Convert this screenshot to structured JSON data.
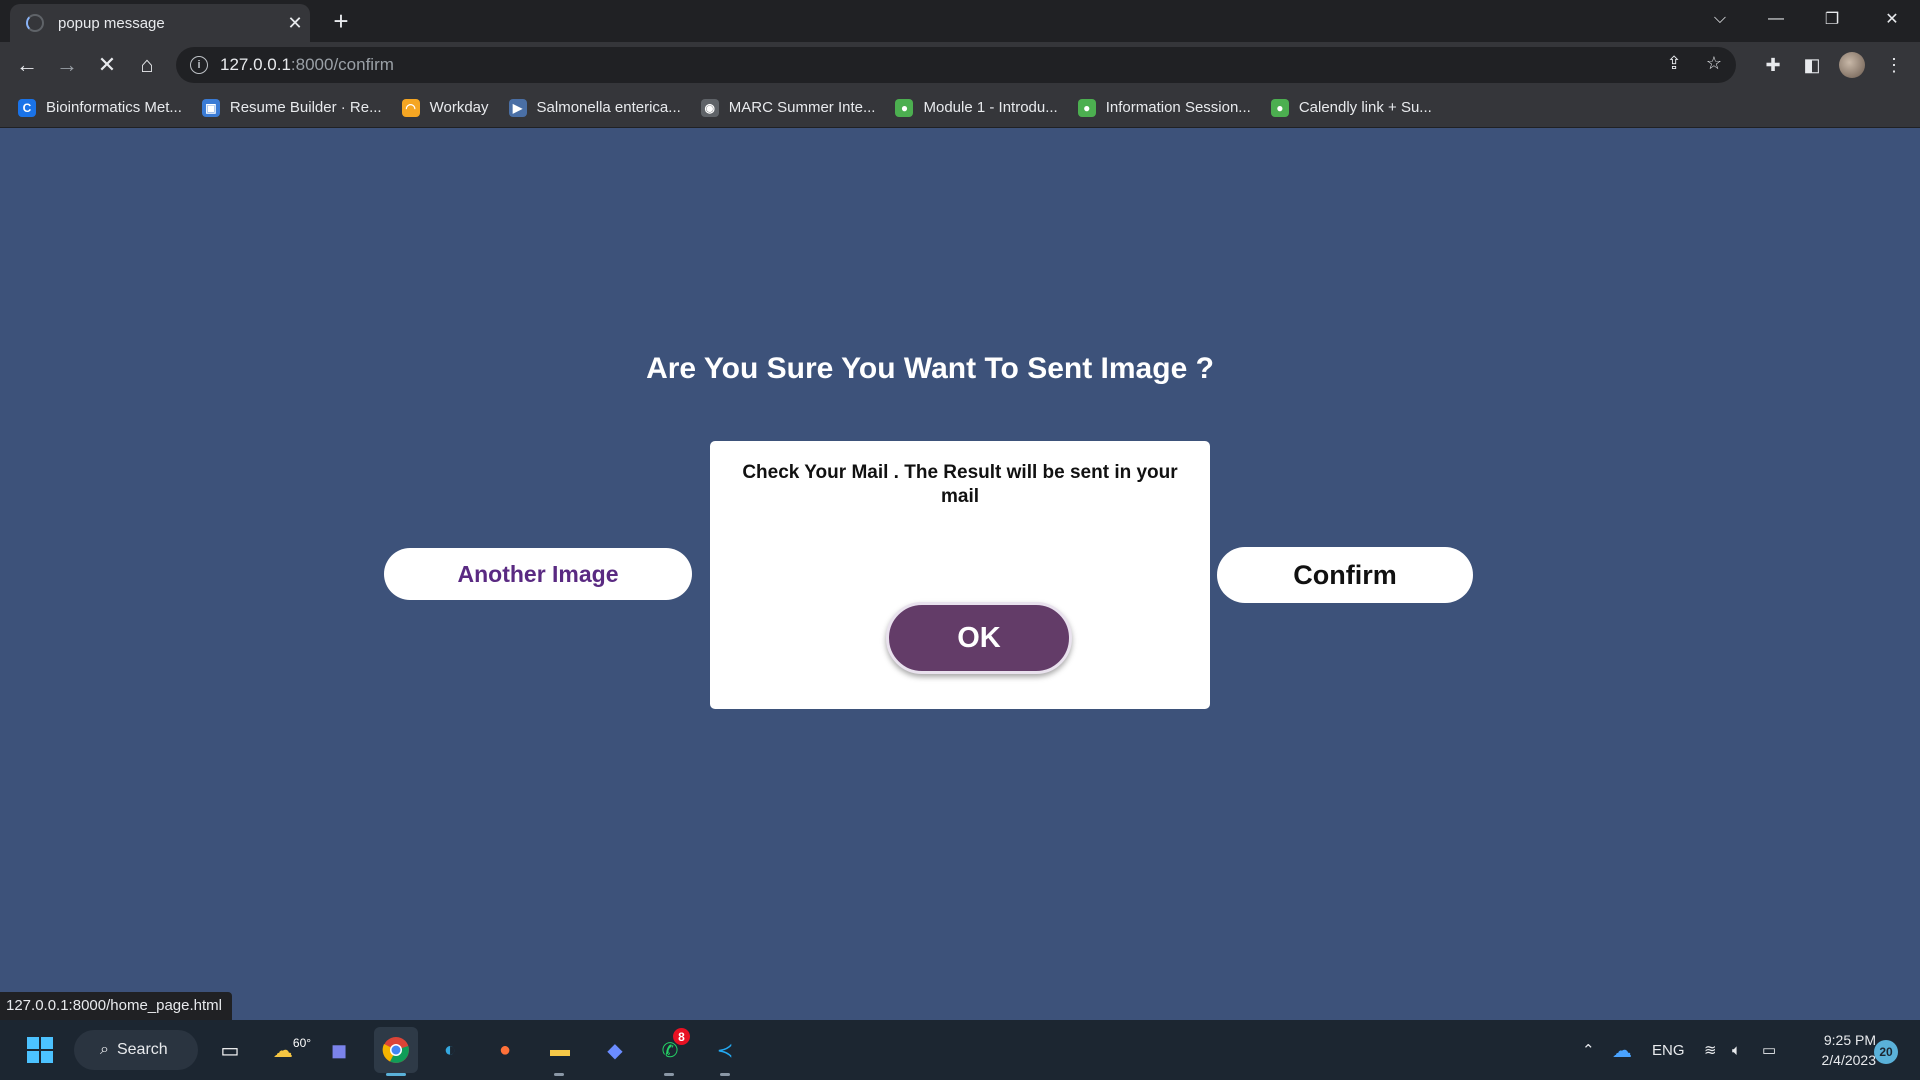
{
  "browser": {
    "tab_title": "popup message",
    "new_tab": "+",
    "url_host": "127.0.0.1",
    "url_path": ":8000/confirm",
    "bookmarks": [
      {
        "label": "Bioinformatics Met...",
        "icon": "c-logo-icon",
        "color": "#1a73e8",
        "glyph": "C"
      },
      {
        "label": "Resume Builder · Re...",
        "icon": "resume-icon",
        "color": "#3a7bd5",
        "glyph": "▣"
      },
      {
        "label": "Workday",
        "icon": "workday-icon",
        "color": "#f5a623",
        "glyph": "◠"
      },
      {
        "label": "Salmonella enterica...",
        "icon": "doc-icon",
        "color": "#4a6fa5",
        "glyph": "▶"
      },
      {
        "label": "MARC Summer Inte...",
        "icon": "globe-icon",
        "color": "#5f6368",
        "glyph": "◉"
      },
      {
        "label": "Module 1 - Introdu...",
        "icon": "pin-icon",
        "color": "#4caf50",
        "glyph": "●"
      },
      {
        "label": "Information Session...",
        "icon": "pin-icon",
        "color": "#4caf50",
        "glyph": "●"
      },
      {
        "label": "Calendly link + Su...",
        "icon": "pin-icon",
        "color": "#4caf50",
        "glyph": "●"
      }
    ]
  },
  "page": {
    "heading": "Are You Sure You Want To Sent Image ?",
    "another_image_label": "Another Image",
    "confirm_label": "Confirm",
    "popup": {
      "message": "Check Your Mail . The Result will be sent in your mail",
      "ok_label": "OK"
    }
  },
  "status_bar": {
    "url": "127.0.0.1:8000/home_page.html"
  },
  "taskbar": {
    "search_label": "Search",
    "weather_temp": "60°",
    "whatsapp_badge": "8",
    "language": "ENG",
    "time": "9:25 PM",
    "date": "2/4/2023",
    "notification_count": "20"
  },
  "colors": {
    "page_background": "#3d527a",
    "ok_button": "#633c68",
    "another_image_text": "#5a2a82"
  }
}
